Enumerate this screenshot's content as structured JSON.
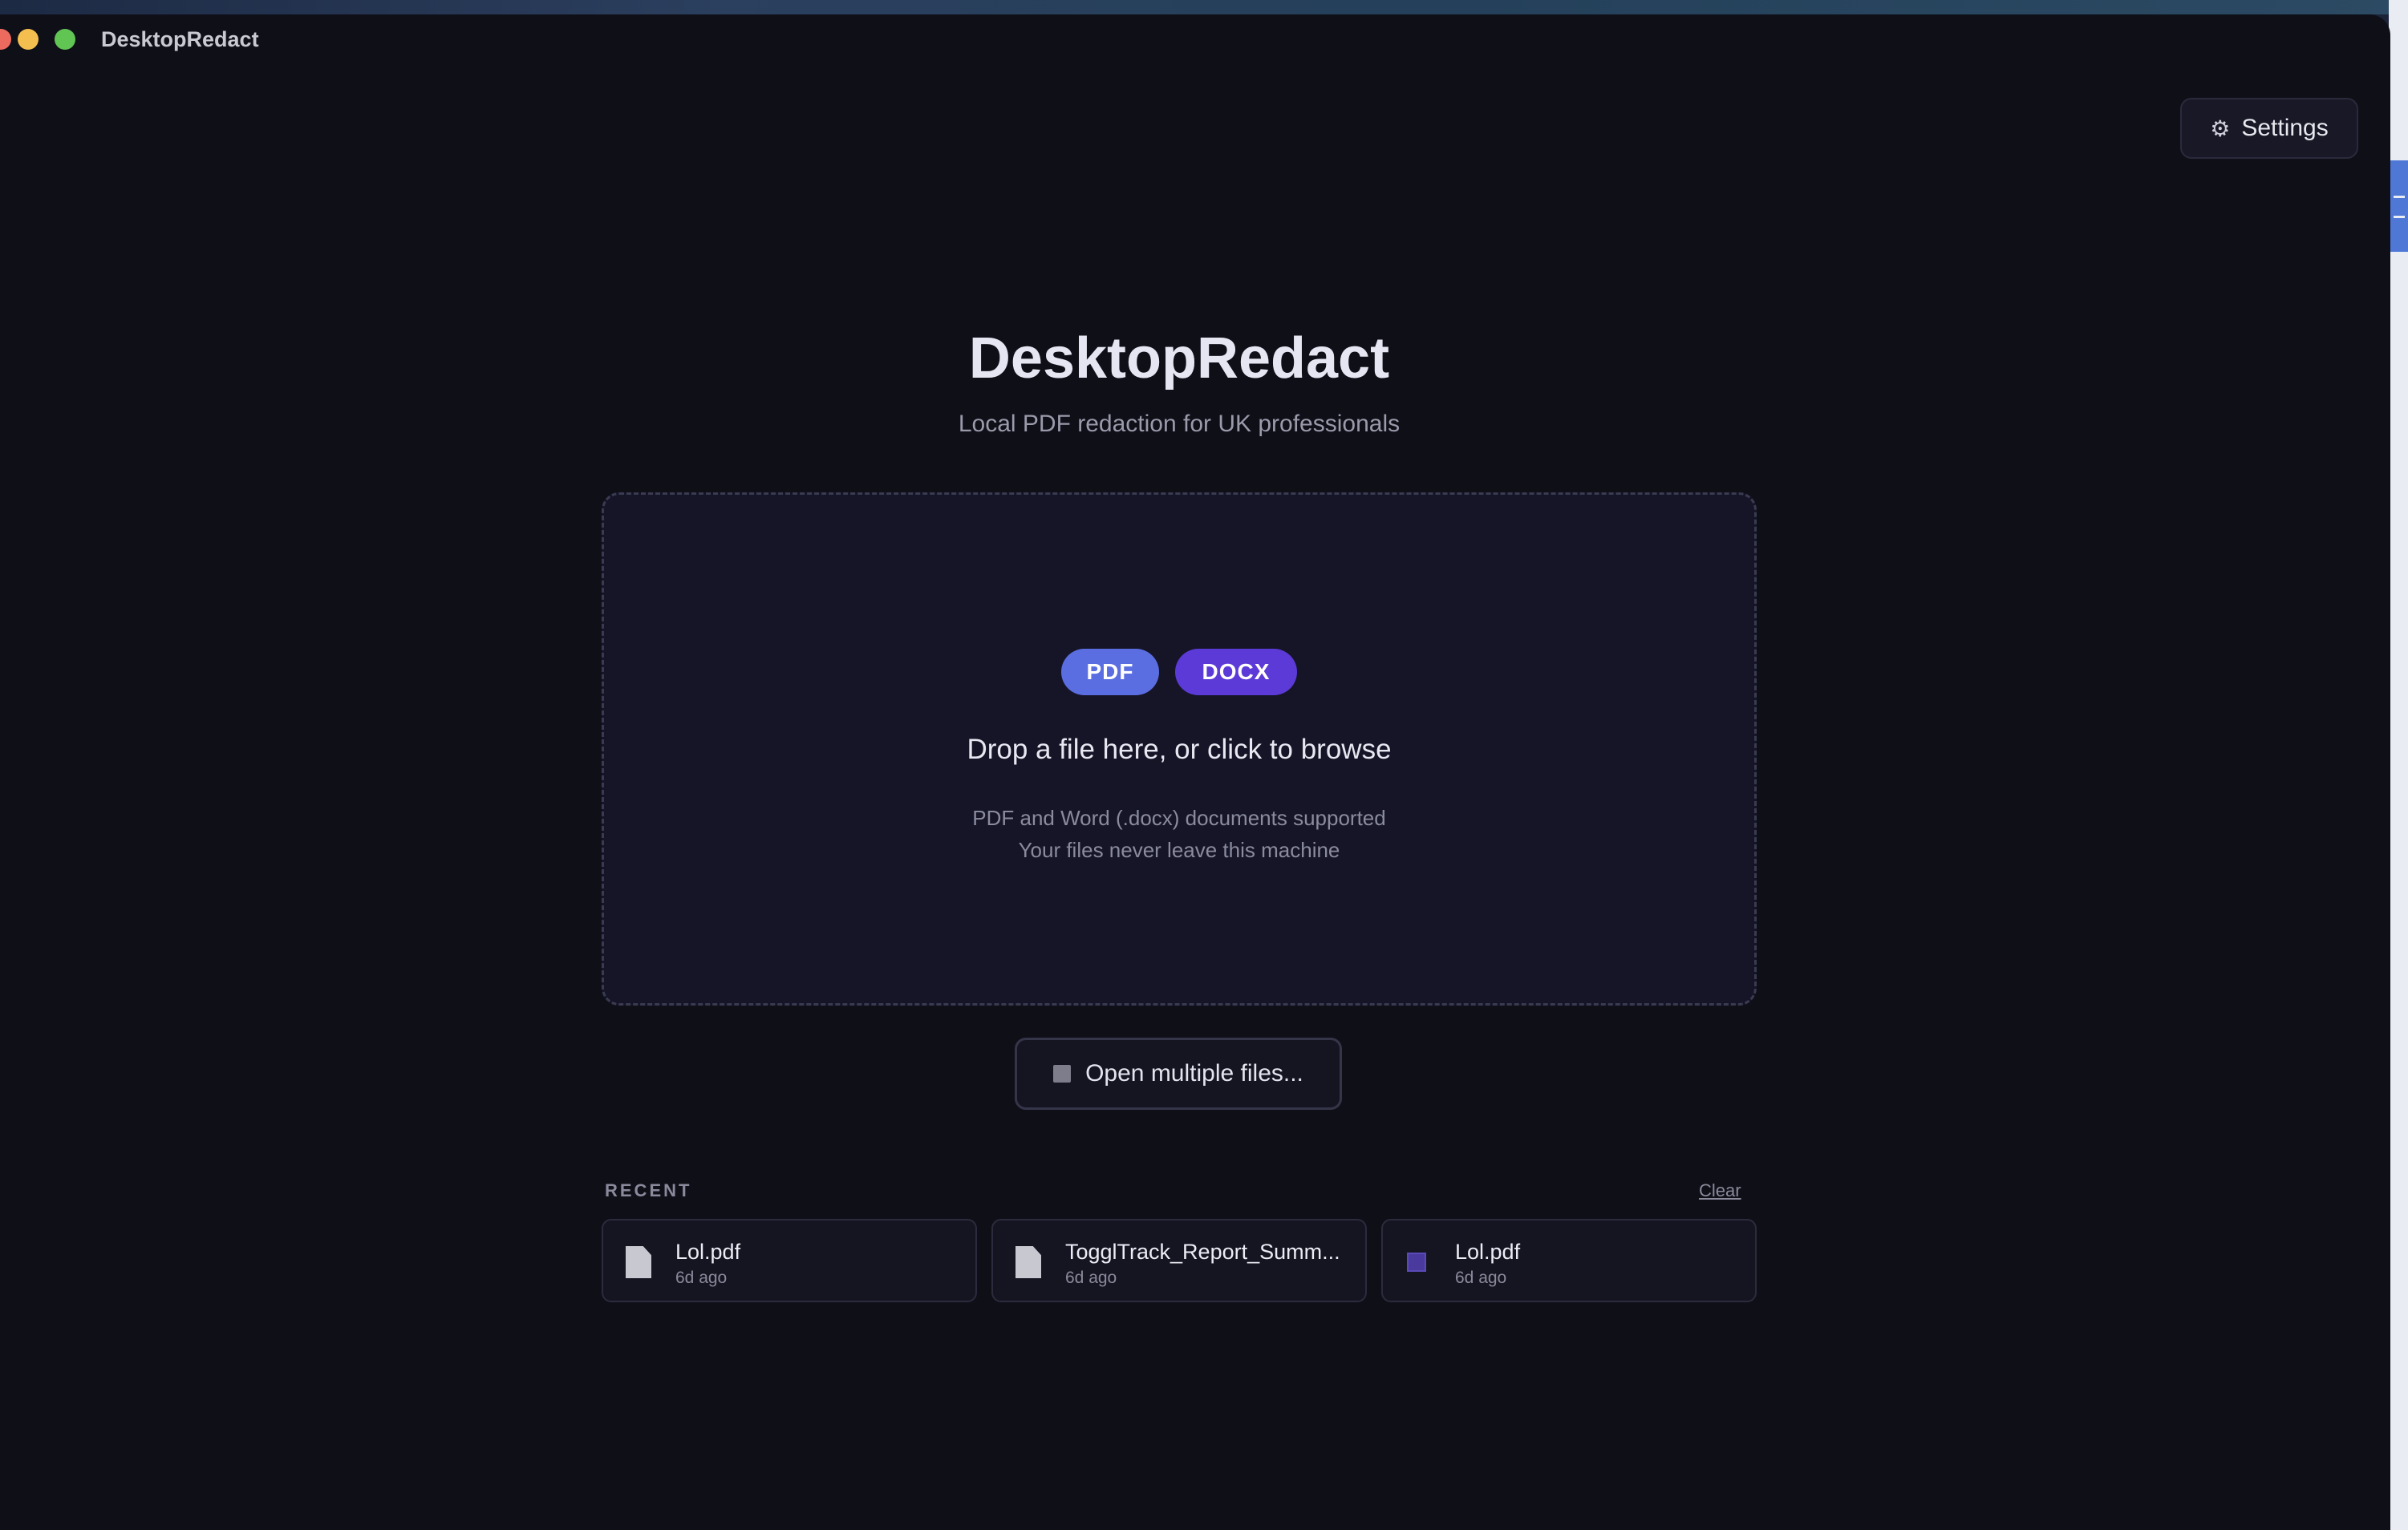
{
  "window": {
    "title": "DesktopRedact"
  },
  "header": {
    "settings_icon": "gear-icon",
    "settings_label": "Settings"
  },
  "hero": {
    "title": "DesktopRedact",
    "subtitle": "Local PDF redaction for UK professionals"
  },
  "dropzone": {
    "badges": [
      "PDF",
      "DOCX"
    ],
    "badge_colors": [
      "#5b6ee1",
      "#5c3ad7"
    ],
    "main_text": "Drop a file here, or click to browse",
    "sub_text_1": "PDF and Word (.docx) documents supported",
    "sub_text_2": "Your files never leave this machine"
  },
  "multi_open": {
    "icon": "square-icon",
    "label": "Open multiple files..."
  },
  "recent": {
    "label": "RECENT",
    "clear_label": "Clear",
    "items": [
      {
        "name": "Lol.pdf",
        "time": "6d ago",
        "icon": "document-icon"
      },
      {
        "name": "TogglTrack_Report_Summ...",
        "time": "6d ago",
        "icon": "document-icon"
      },
      {
        "name": "Lol.pdf",
        "time": "6d ago",
        "icon": "purple-square-icon"
      }
    ]
  },
  "colors": {
    "background": "#0f0f18",
    "dropzone_bg": "#151527",
    "accent_pdf": "#5b6ee1",
    "accent_docx": "#5c3ad7"
  }
}
